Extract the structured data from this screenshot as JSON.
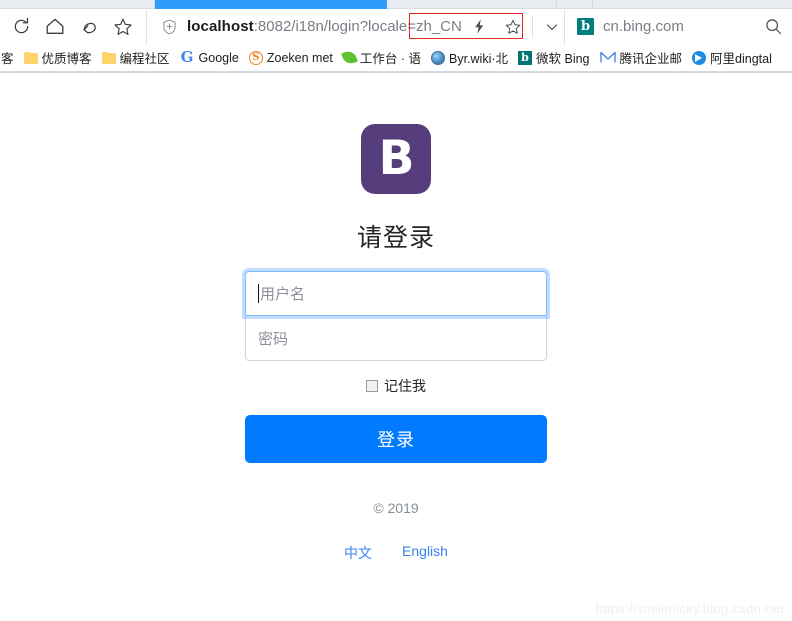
{
  "browser": {
    "toolbar_icons": [
      {
        "name": "refresh-icon",
        "label": "refresh"
      },
      {
        "name": "home-icon",
        "label": "home"
      },
      {
        "name": "back-icon",
        "label": "back"
      },
      {
        "name": "favorites-star-icon",
        "label": "favorites"
      }
    ],
    "url": {
      "shield_icon": "shield-icon",
      "host": "localhost",
      "path": ":8082/i18n/login",
      "query": "?locale=zh_CN",
      "full": "localhost:8082/i18n/login?locale=zh_CN",
      "annotation_color": "#e3281f"
    },
    "url_actions": [
      {
        "name": "lightning-icon",
        "label": "lightning"
      },
      {
        "name": "bookmark-star-icon",
        "label": "bookmark"
      },
      {
        "name": "chevron-down-icon",
        "label": "more"
      }
    ],
    "search": {
      "engine_logo_text": "b",
      "engine_logo_color": "#017f7f",
      "value": "cn.bing.com",
      "go_icon": "search-icon"
    },
    "bookmarks": [
      {
        "label": "客",
        "icon": "clipped-bookmark-icon",
        "clipped": true
      },
      {
        "label": "优质博客",
        "icon": "folder-icon"
      },
      {
        "label": "编程社区",
        "icon": "folder-icon"
      },
      {
        "label": "Google",
        "icon": "google-icon"
      },
      {
        "label": "Zoeken met",
        "icon": "startpage-s-icon"
      },
      {
        "label": "工作台 · 语",
        "icon": "leaf-icon"
      },
      {
        "label": "Byr.wiki·北",
        "icon": "globe-icon"
      },
      {
        "label": "微软 Bing",
        "icon": "bing-icon"
      },
      {
        "label": "腾讯企业邮",
        "icon": "qq-mail-icon"
      },
      {
        "label": "阿里dingtal",
        "icon": "dingtalk-icon"
      }
    ]
  },
  "login": {
    "logo_letter": "B",
    "logo_color": "#563d7c",
    "title": "请登录",
    "username": {
      "value": "",
      "placeholder": "用户名"
    },
    "password": {
      "value": "",
      "placeholder": "密码"
    },
    "remember_label": "记住我",
    "remember_checked": false,
    "submit_label": "登录",
    "submit_color": "#007bff",
    "copyright": "© 2019",
    "lang_links": [
      {
        "label": "中文",
        "code": "zh_CN"
      },
      {
        "label": "English",
        "code": "en_US"
      }
    ]
  },
  "watermark": "https://smilenicky.blog.csdn.net"
}
